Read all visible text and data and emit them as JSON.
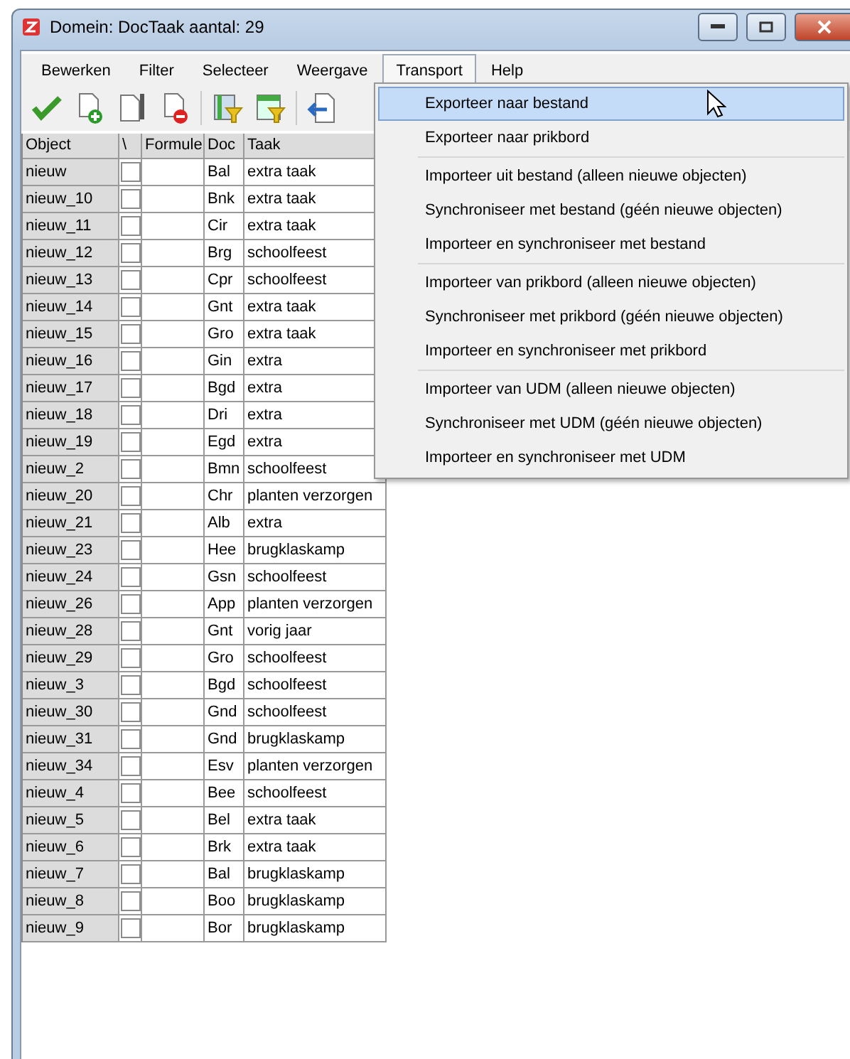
{
  "window": {
    "title": "Domein: DocTaak aantal: 29"
  },
  "menu_bar": [
    {
      "label": "Bewerken",
      "selected": false
    },
    {
      "label": "Filter",
      "selected": false
    },
    {
      "label": "Selecteer",
      "selected": false
    },
    {
      "label": "Weergave",
      "selected": false
    },
    {
      "label": "Transport",
      "selected": true
    },
    {
      "label": "Help",
      "selected": false
    }
  ],
  "dropdown": [
    {
      "kind": "item",
      "label": "Exporteer naar bestand",
      "selected": true
    },
    {
      "kind": "item",
      "label": "Exporteer naar prikbord",
      "selected": false
    },
    {
      "kind": "separator"
    },
    {
      "kind": "item",
      "label": "Importeer uit bestand (alleen nieuwe objecten)",
      "selected": false
    },
    {
      "kind": "item",
      "label": "Synchroniseer met bestand (géén nieuwe objecten)",
      "selected": false
    },
    {
      "kind": "item",
      "label": "Importeer en synchroniseer met bestand",
      "selected": false
    },
    {
      "kind": "separator"
    },
    {
      "kind": "item",
      "label": "Importeer van prikbord (alleen nieuwe objecten)",
      "selected": false
    },
    {
      "kind": "item",
      "label": "Synchroniseer met prikbord (géén nieuwe objecten)",
      "selected": false
    },
    {
      "kind": "item",
      "label": "Importeer en synchroniseer met prikbord",
      "selected": false
    },
    {
      "kind": "separator"
    },
    {
      "kind": "item",
      "label": "Importeer van UDM (alleen nieuwe objecten)",
      "selected": false
    },
    {
      "kind": "item",
      "label": "Synchroniseer met UDM (géén nieuwe objecten)",
      "selected": false
    },
    {
      "kind": "item",
      "label": "Importeer en synchroniseer met UDM",
      "selected": false
    }
  ],
  "table": {
    "columns": [
      "Object",
      "\\",
      "Formule",
      "Doc",
      "Taak"
    ],
    "rows": [
      {
        "object": "nieuw",
        "checked": false,
        "doc": "Bal",
        "taak": "extra taak"
      },
      {
        "object": "nieuw_10",
        "checked": false,
        "doc": "Bnk",
        "taak": "extra taak"
      },
      {
        "object": "nieuw_11",
        "checked": false,
        "doc": "Cir",
        "taak": "extra taak"
      },
      {
        "object": "nieuw_12",
        "checked": false,
        "doc": "Brg",
        "taak": "schoolfeest"
      },
      {
        "object": "nieuw_13",
        "checked": false,
        "doc": "Cpr",
        "taak": "schoolfeest"
      },
      {
        "object": "nieuw_14",
        "checked": false,
        "doc": "Gnt",
        "taak": "extra taak"
      },
      {
        "object": "nieuw_15",
        "checked": false,
        "doc": "Gro",
        "taak": "extra taak"
      },
      {
        "object": "nieuw_16",
        "checked": false,
        "doc": "Gin",
        "taak": "extra"
      },
      {
        "object": "nieuw_17",
        "checked": false,
        "doc": "Bgd",
        "taak": "extra"
      },
      {
        "object": "nieuw_18",
        "checked": false,
        "doc": "Dri",
        "taak": "extra"
      },
      {
        "object": "nieuw_19",
        "checked": false,
        "doc": "Egd",
        "taak": "extra"
      },
      {
        "object": "nieuw_2",
        "checked": false,
        "doc": "Bmn",
        "taak": "schoolfeest"
      },
      {
        "object": "nieuw_20",
        "checked": false,
        "doc": "Chr",
        "taak": "planten verzorgen"
      },
      {
        "object": "nieuw_21",
        "checked": false,
        "doc": "Alb",
        "taak": "extra"
      },
      {
        "object": "nieuw_23",
        "checked": false,
        "doc": "Hee",
        "taak": "brugklaskamp"
      },
      {
        "object": "nieuw_24",
        "checked": false,
        "doc": "Gsn",
        "taak": "schoolfeest"
      },
      {
        "object": "nieuw_26",
        "checked": false,
        "doc": "App",
        "taak": "planten verzorgen"
      },
      {
        "object": "nieuw_28",
        "checked": false,
        "doc": "Gnt",
        "taak": "vorig jaar"
      },
      {
        "object": "nieuw_29",
        "checked": false,
        "doc": "Gro",
        "taak": "schoolfeest"
      },
      {
        "object": "nieuw_3",
        "checked": false,
        "doc": "Bgd",
        "taak": "schoolfeest"
      },
      {
        "object": "nieuw_30",
        "checked": false,
        "doc": "Gnd",
        "taak": "schoolfeest"
      },
      {
        "object": "nieuw_31",
        "checked": false,
        "doc": "Gnd",
        "taak": "brugklaskamp"
      },
      {
        "object": "nieuw_34",
        "checked": false,
        "doc": "Esv",
        "taak": "planten verzorgen"
      },
      {
        "object": "nieuw_4",
        "checked": false,
        "doc": "Bee",
        "taak": "schoolfeest"
      },
      {
        "object": "nieuw_5",
        "checked": false,
        "doc": "Bel",
        "taak": "extra taak"
      },
      {
        "object": "nieuw_6",
        "checked": false,
        "doc": "Brk",
        "taak": "extra taak"
      },
      {
        "object": "nieuw_7",
        "checked": false,
        "doc": "Bal",
        "taak": "brugklaskamp"
      },
      {
        "object": "nieuw_8",
        "checked": false,
        "doc": "Boo",
        "taak": "brugklaskamp"
      },
      {
        "object": "nieuw_9",
        "checked": false,
        "doc": "Bor",
        "taak": "brugklaskamp"
      }
    ]
  }
}
